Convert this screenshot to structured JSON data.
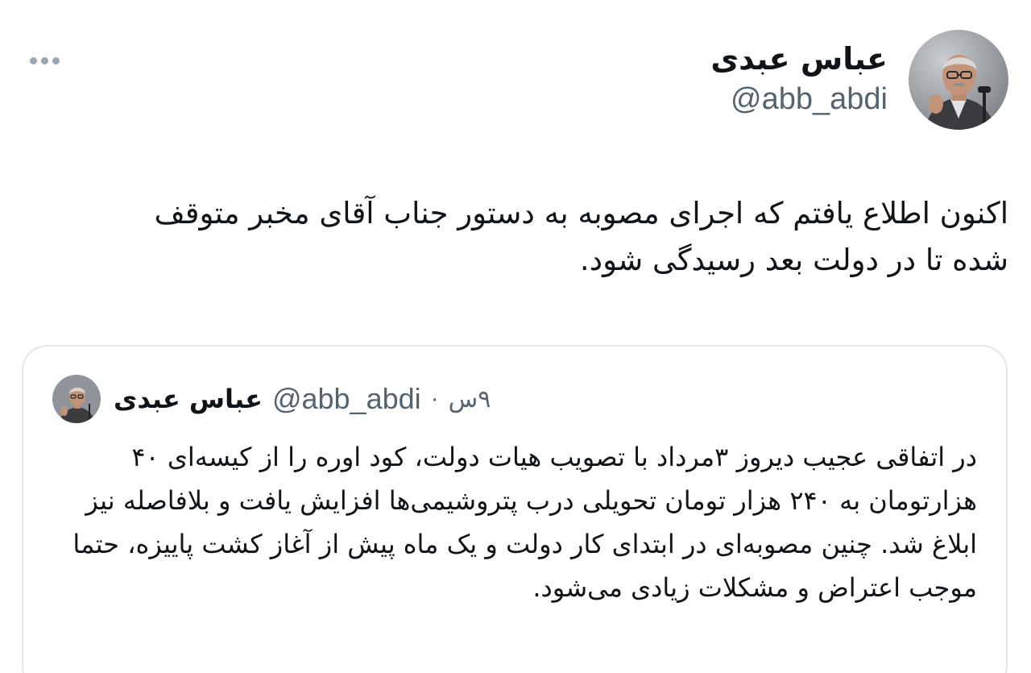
{
  "tweet": {
    "author": {
      "display_name": "عباس عبدی",
      "handle": "@abb_abdi",
      "avatar_icon": "profile-photo"
    },
    "more_icon": "more-horizontal-icon",
    "text": "اکنون اطلاع یافتم که اجرای مصوبه به دستور جناب آقای مخبر متوقف شده تا در دولت بعد رسیدگی شود."
  },
  "quoted": {
    "author": {
      "display_name": "عباس عبدی",
      "handle": "@abb_abdi",
      "avatar_icon": "profile-photo"
    },
    "separator": "·",
    "time": "۹س",
    "text": "در اتفاقی عجیب دیروز ۳مرداد با تصویب هیات دولت، کود اوره را از کیسه‌ای ۴۰ هزارتومان به ۲۴۰ هزار تومان تحویلی درب پتروشیمی‌ها افزایش یافت و بلافاصله نیز ابلاغ شد. چنین مصوبه‌ای در ابتدای کار دولت و یک ماه پیش از آغاز کشت پاییزه، حتما موجب اعتراض و مشکلات زیادی می‌شود."
  },
  "colors": {
    "text_primary": "#0f1419",
    "text_secondary": "#536471",
    "border": "#e1e8ed",
    "dots": "#9aa6b1"
  }
}
